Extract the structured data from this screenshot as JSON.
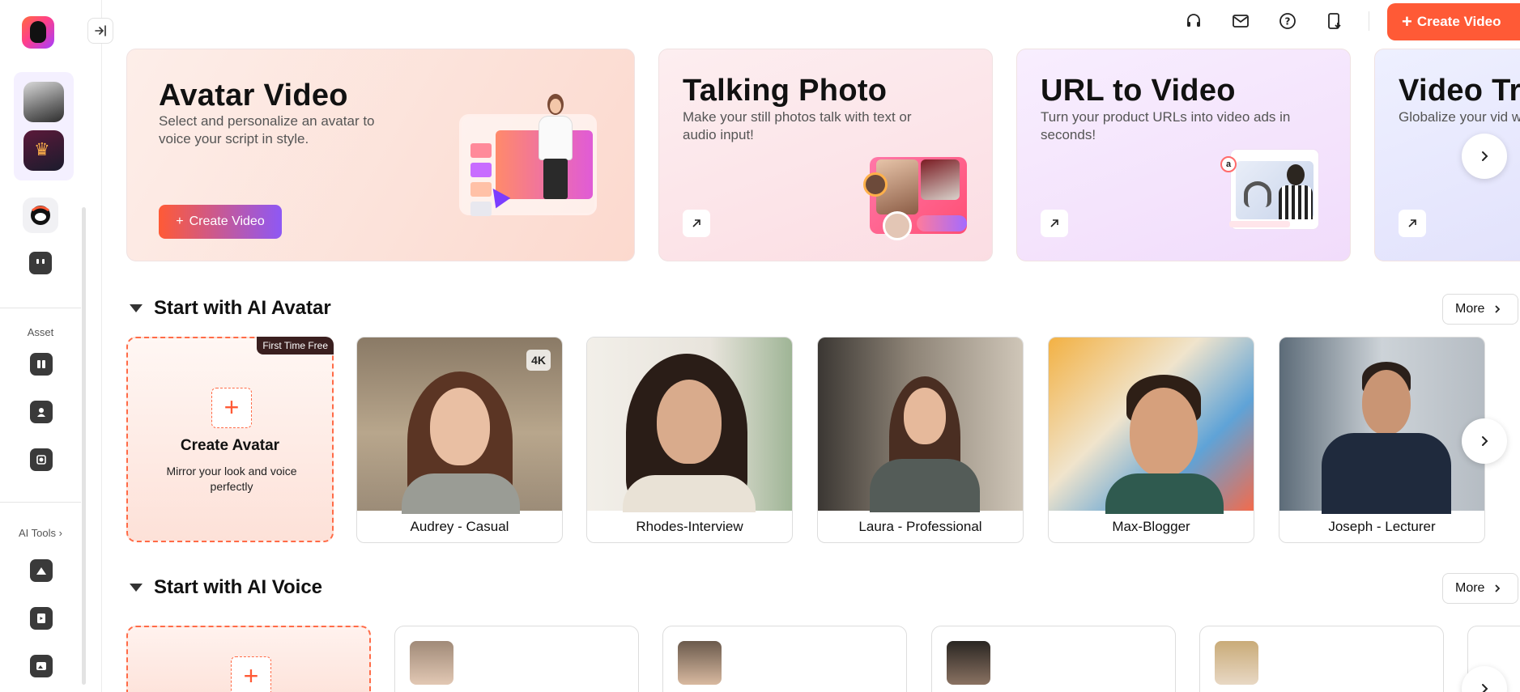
{
  "sidebar": {
    "logo": "app-logo",
    "collapse_icon": "collapse-sidebar-icon",
    "asset_label": "Asset",
    "ai_tools_label": "AI Tools",
    "ai_tools_chevron": "›"
  },
  "topbar": {
    "icons": [
      "headset-icon",
      "mail-icon",
      "help-icon",
      "download-icon"
    ],
    "create_video_label": "Create Video"
  },
  "features": [
    {
      "title": "Avatar Video",
      "desc": "Select and personalize an avatar to voice your script in style.",
      "button": "Create Video"
    },
    {
      "title": "Talking Photo",
      "desc": "Make your still photos talk with text or audio input!"
    },
    {
      "title": "URL to Video",
      "desc": "Turn your product URLs into video ads in seconds!"
    },
    {
      "title": "Video Tr",
      "desc": "Globalize your vid with voice an"
    }
  ],
  "avatar_section": {
    "title": "Start with AI Avatar",
    "more": "More",
    "create": {
      "badge": "First Time Free",
      "title": "Create Avatar",
      "subtitle": "Mirror your look and voice perfectly"
    },
    "avatars": [
      {
        "name": "Audrey - Casual",
        "badge": "4K"
      },
      {
        "name": "Rhodes-Interview"
      },
      {
        "name": "Laura - Professional"
      },
      {
        "name": "Max-Blogger"
      },
      {
        "name": "Joseph - Lecturer"
      }
    ]
  },
  "voice_section": {
    "title": "Start with AI Voice",
    "more": "More"
  },
  "colors": {
    "accent": "#ff5a36",
    "purple": "#8e58f5"
  }
}
